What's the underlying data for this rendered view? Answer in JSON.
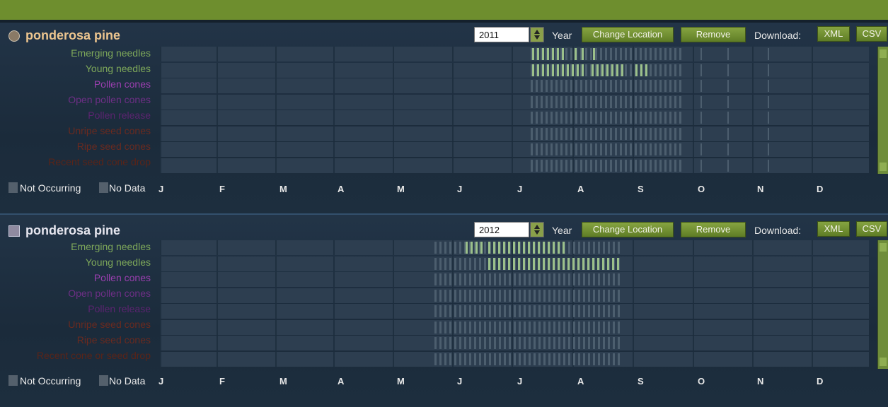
{
  "months": [
    "J",
    "F",
    "M",
    "A",
    "M",
    "J",
    "J",
    "A",
    "S",
    "O",
    "N",
    "D"
  ],
  "legend": {
    "not_occurring": "Not Occurring",
    "no_data": "No Data"
  },
  "download_label": "Download:",
  "year_label": "Year",
  "panels": [
    {
      "species": "ponderosa pine",
      "year": "2011",
      "buttons": {
        "change_location": "Change Location",
        "remove": "Remove",
        "xml": "XML",
        "csv": "CSV"
      },
      "phenophases": [
        {
          "label": "Emerging needles",
          "color": "#7ea85a"
        },
        {
          "label": "Young needles",
          "color": "#7ea85a"
        },
        {
          "label": "Pollen cones",
          "color": "#9b3fb0"
        },
        {
          "label": "Open pollen cones",
          "color": "#6e2f86"
        },
        {
          "label": "Pollen release",
          "color": "#5b2470"
        },
        {
          "label": "Unripe seed cones",
          "color": "#6a2a1f"
        },
        {
          "label": "Ripe seed cones",
          "color": "#6a2a1f"
        },
        {
          "label": "Recent seed cone drop",
          "color": "#5a2418"
        }
      ]
    },
    {
      "species": "ponderosa pine",
      "year": "2012",
      "buttons": {
        "change_location": "Change Location",
        "remove": "Remove",
        "xml": "XML",
        "csv": "CSV"
      },
      "phenophases": [
        {
          "label": "Emerging needles",
          "color": "#7ea85a"
        },
        {
          "label": "Young needles",
          "color": "#7ea85a"
        },
        {
          "label": "Pollen cones",
          "color": "#9b3fb0"
        },
        {
          "label": "Open pollen cones",
          "color": "#6e2f86"
        },
        {
          "label": "Pollen release",
          "color": "#5b2470"
        },
        {
          "label": "Unripe seed cones",
          "color": "#6a2a1f"
        },
        {
          "label": "Ripe seed cones",
          "color": "#6a2a1f"
        },
        {
          "label": "Recent cone or seed drop",
          "color": "#5a2418"
        }
      ]
    }
  ],
  "colors": {
    "accent": "#6e8e2e",
    "yes": "#9bc08a",
    "no": "#4c5e6e"
  }
}
